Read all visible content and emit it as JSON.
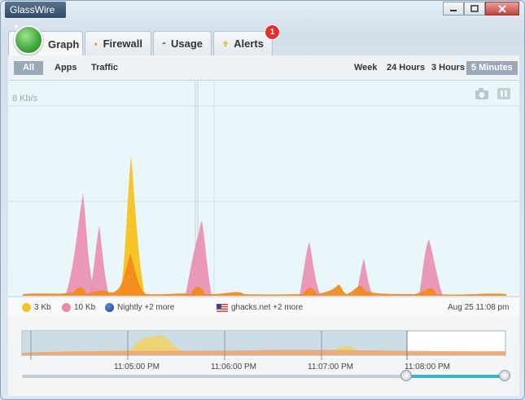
{
  "app": {
    "menu_label": "GlassWire"
  },
  "tabs": [
    {
      "label": "Graph",
      "icon": "graph-icon"
    },
    {
      "label": "Firewall",
      "icon": "fire-icon"
    },
    {
      "label": "Usage",
      "icon": "usage-icon"
    },
    {
      "label": "Alerts",
      "icon": "bulb-icon",
      "badge": "1"
    }
  ],
  "filters": {
    "all": "All",
    "apps": "Apps",
    "traffic": "Traffic"
  },
  "ranges": {
    "week": "Week",
    "h24": "24 Hours",
    "h3": "3 Hours",
    "m5": "5 Minutes"
  },
  "graph": {
    "scale_label": "8 Kb/s"
  },
  "legend": {
    "down": "3 Kb",
    "up": "10 Kb",
    "app": "Nightly +2 more",
    "host": "ghacks.net +2 more",
    "time": "Aug 25 11:08 pm"
  },
  "timeline": {
    "ticks": [
      "11:05:00 PM",
      "11:06:00 PM",
      "11:07:00 PM",
      "11:08:00 PM"
    ]
  },
  "colors": {
    "incoming": "#f6c22a",
    "outgoing": "#e88aa8",
    "orange": "#f28a1e",
    "accent": "#3bb3c6"
  }
}
